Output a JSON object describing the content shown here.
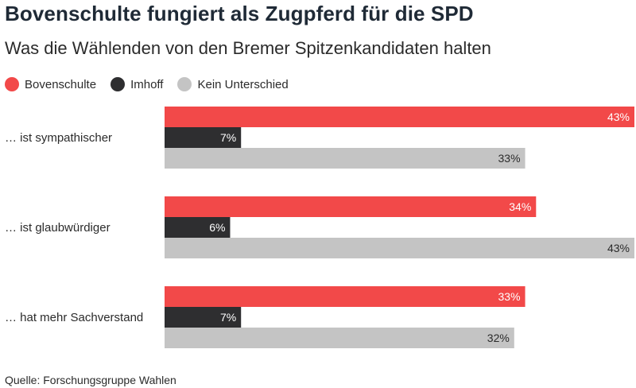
{
  "title": "Bovenschulte fungiert als Zugpferd für die SPD",
  "subtitle": "Was die Wählenden von den Bremer Spitzenkandidaten halten",
  "source": "Quelle: Forschungsgruppe Wahlen",
  "chart_data": {
    "type": "bar",
    "orientation": "horizontal",
    "categories": [
      "… ist sympathischer",
      "… ist glaubwürdiger",
      "… hat mehr Sachverstand"
    ],
    "series": [
      {
        "name": "Bovenschulte",
        "color": "#f24949",
        "label_color": "#ffffff",
        "values": [
          43,
          34,
          33
        ]
      },
      {
        "name": "Imhoff",
        "color": "#2e2e30",
        "label_color": "#ffffff",
        "values": [
          7,
          6,
          7
        ]
      },
      {
        "name": "Kein Unterschied",
        "color": "#c4c4c4",
        "label_color": "#2b2b2b",
        "values": [
          33,
          43,
          32
        ]
      }
    ],
    "value_suffix": "%",
    "xlim": [
      0,
      43
    ],
    "legend_position": "top-left",
    "grid": false
  }
}
